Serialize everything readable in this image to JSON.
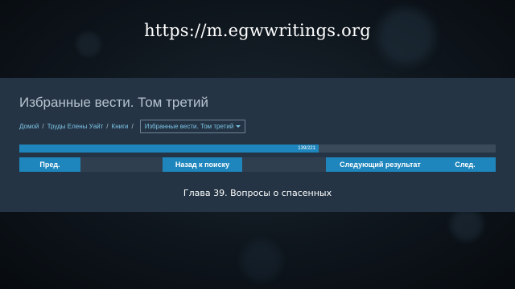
{
  "site_url": "https://m.egwwritings.org",
  "book": {
    "title": "Избранные вести. Том третий"
  },
  "breadcrumb": {
    "items": [
      "Домой",
      "Труды Елены Уайт",
      "Книги"
    ],
    "separator": "/",
    "current": "Избранные вести. Том третий"
  },
  "progress": {
    "current": 139,
    "total": 221,
    "label": "139/221"
  },
  "nav": {
    "prev_label": "Пред.",
    "back_label": "Назад к поиску",
    "next_result_label": "Следующий результат",
    "next_label": "След."
  },
  "chapter": {
    "title": "Глава 39. Вопросы о спасенных"
  },
  "colors": {
    "panel": "#243444",
    "accent": "#1f86bd",
    "link": "#7dc4e6"
  },
  "icons": {
    "dropdown": "caret-down-icon"
  }
}
